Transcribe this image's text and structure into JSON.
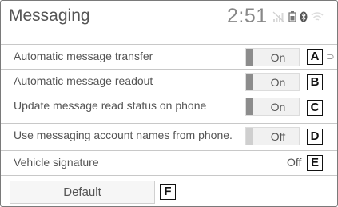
{
  "header": {
    "title": "Messaging",
    "time": "2:51",
    "status_icons": [
      "signal-icon",
      "battery-icon",
      "bluetooth-icon",
      "wifi-icon"
    ]
  },
  "settings": [
    {
      "label": "Automatic message transfer",
      "value": "On",
      "tag": "A"
    },
    {
      "label": "Automatic message readout",
      "value": "On",
      "tag": "B"
    },
    {
      "label": "Update message read status on phone",
      "value": "On",
      "tag": "C"
    },
    {
      "label": "Use messaging account names from phone.",
      "value": "Off",
      "tag": "D"
    },
    {
      "label": "Vehicle signature",
      "value": "Off",
      "tag": "E"
    }
  ],
  "default_button": {
    "label": "Default",
    "tag": "F"
  },
  "colors": {
    "indicator_on": "#8c8c8c",
    "indicator_off": "#cfcfcf",
    "border": "#c8c8c8"
  }
}
